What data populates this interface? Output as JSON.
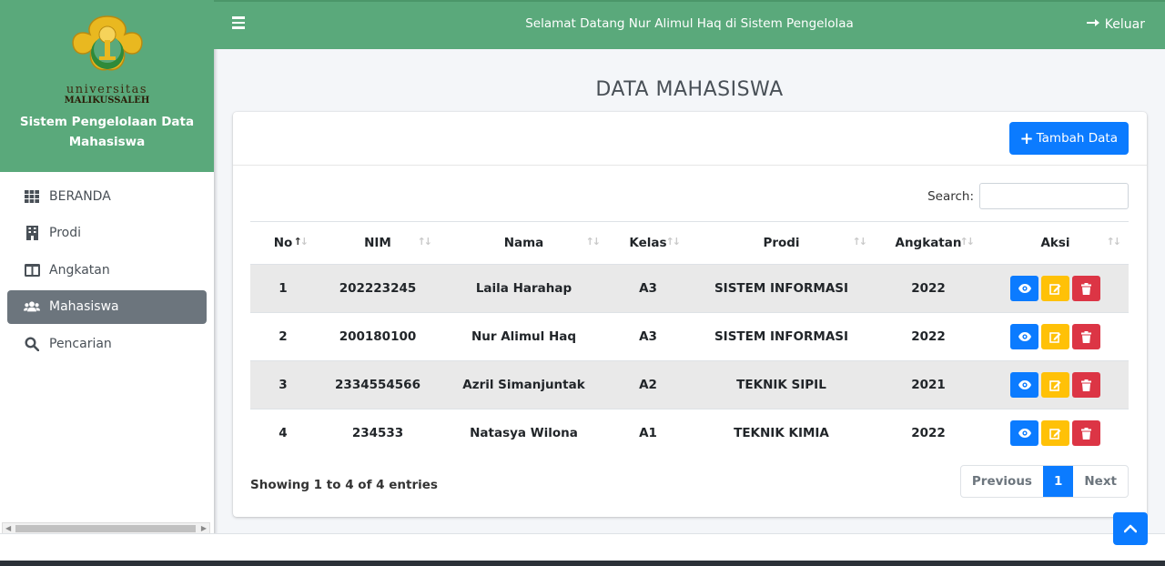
{
  "brand": {
    "logo_text_1": "universitas",
    "logo_text_2": "MALIKUSSALEH",
    "title": "Sistem Pengelolaan Data Mahasiswa"
  },
  "sidebar": {
    "items": [
      {
        "label": "BERANDA",
        "icon": "grid-icon",
        "active": false
      },
      {
        "label": "Prodi",
        "icon": "building-icon",
        "active": false
      },
      {
        "label": "Angkatan",
        "icon": "columns-icon",
        "active": false
      },
      {
        "label": "Mahasiswa",
        "icon": "users-icon",
        "active": true
      },
      {
        "label": "Pencarian",
        "icon": "search-icon",
        "active": false
      }
    ]
  },
  "topbar": {
    "welcome": "Selamat Datang Nur Alimul Haq di Sistem Pengelolaa",
    "logout_label": "Keluar"
  },
  "page": {
    "title": "DATA MAHASISWA",
    "add_button": "Tambah Data",
    "search_label": "Search:",
    "search_value": ""
  },
  "table": {
    "headers": [
      "No",
      "NIM",
      "Nama",
      "Kelas",
      "Prodi",
      "Angkatan",
      "Aksi"
    ],
    "rows": [
      {
        "no": "1",
        "nim": "202223245",
        "nama": "Laila Harahap",
        "kelas": "A3",
        "prodi": "SISTEM INFORMASI",
        "angkatan": "2022"
      },
      {
        "no": "2",
        "nim": "200180100",
        "nama": "Nur Alimul Haq",
        "kelas": "A3",
        "prodi": "SISTEM INFORMASI",
        "angkatan": "2022"
      },
      {
        "no": "3",
        "nim": "2334554566",
        "nama": "Azril Simanjuntak",
        "kelas": "A2",
        "prodi": "TEKNIK SIPIL",
        "angkatan": "2021"
      },
      {
        "no": "4",
        "nim": "234533",
        "nama": "Natasya Wilona",
        "kelas": "A1",
        "prodi": "TEKNIK KIMIA",
        "angkatan": "2022"
      }
    ]
  },
  "pagination": {
    "info": "Showing 1 to 4 of 4 entries",
    "previous": "Previous",
    "current": "1",
    "next": "Next"
  },
  "colors": {
    "brand_green": "#5aa97b",
    "primary": "#0b7bff",
    "warning": "#ffc107",
    "danger": "#dc3545"
  }
}
